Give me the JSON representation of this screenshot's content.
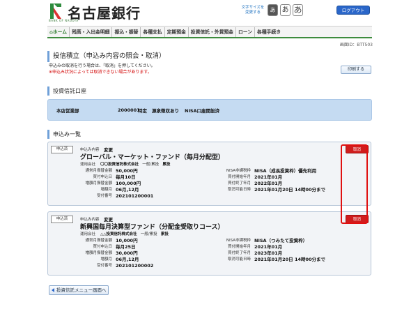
{
  "header": {
    "bank_name": "名古屋銀行",
    "logo_sub": "BANK OF NAGOYA",
    "font_size_label_line1": "文字サイズを",
    "font_size_label_line2": "変更する",
    "font_small": "あ",
    "font_medium": "あ",
    "font_large": "あ",
    "logout_label": "ログアウト"
  },
  "nav": {
    "items": [
      "ホーム",
      "残高・入出金明細",
      "振込・振替",
      "各種支払",
      "定期預金",
      "投資信託・外貨預金",
      "ローン",
      "各種手続き"
    ]
  },
  "screen_id": "画面ID：BTT503",
  "page": {
    "title": "投信積立（申込み内容の照会・取消）",
    "note1": "申込みの取消を行う場合は、「取消」を押してください。",
    "note2": "※申込み状況によっては取消できない場合があります。",
    "print_label": "印刷する"
  },
  "account_section": {
    "title": "投資信託口座",
    "branch": "本店営業部",
    "number": "2000001",
    "type": "特定",
    "tax": "源泉徴収あり",
    "nisa": "NISA口座開設済"
  },
  "list_section": {
    "title": "申込み一覧"
  },
  "cards": [
    {
      "status": "申込済",
      "content_label": "申込み内容",
      "content_value": "変更",
      "fund_name": "グローバル・マーケット・ファンド（毎月分配型）",
      "company_label": "運用会社",
      "company_value": "〇〇投資信託株式会社",
      "category": "一般/累投",
      "course": "累投",
      "cancel_label": "取消",
      "left": [
        {
          "label": "通常月振替金額",
          "value": "50,000円"
        },
        {
          "label": "買付申込日",
          "value": "毎月10日"
        },
        {
          "label": "増額月振替金額",
          "value": "100,000円"
        },
        {
          "label": "増額月",
          "value": "06月,12月"
        },
        {
          "label": "受付番号",
          "value": "202101200001"
        }
      ],
      "right": [
        {
          "label": "NISA非課税枠",
          "value": "NISA（成長投資枠）優先利用"
        },
        {
          "label": "買付開始年月",
          "value": "2021年01月"
        },
        {
          "label": "買付終了年月",
          "value": "2022年01月"
        },
        {
          "label": "取消可能日時",
          "value": "2021年01月20日 14時00分まで"
        }
      ]
    },
    {
      "status": "申込済",
      "content_label": "申込み内容",
      "content_value": "変更",
      "fund_name": "新興国毎月決算型ファンド（分配金受取りコース）",
      "company_label": "運用会社",
      "company_value": "△△投資信託株式会社",
      "category": "一般/累投",
      "course": "累投",
      "cancel_label": "取消",
      "left": [
        {
          "label": "通常月振替金額",
          "value": "10,000円"
        },
        {
          "label": "買付申込日",
          "value": "毎月25日"
        },
        {
          "label": "増額月振替金額",
          "value": "30,000円"
        },
        {
          "label": "増額月",
          "value": "06月,12月"
        },
        {
          "label": "受付番号",
          "value": "202101200002"
        }
      ],
      "right": [
        {
          "label": "NISA非課税枠",
          "value": "NISA（つみたて投資枠）"
        },
        {
          "label": "買付開始年月",
          "value": "2021年01月"
        },
        {
          "label": "買付終了年月",
          "value": "2023年01月"
        },
        {
          "label": "取消可能日時",
          "value": "2021年01月20日 14時00分まで"
        }
      ]
    }
  ],
  "footer": {
    "back_label": "投資信託メニュー画面へ"
  }
}
